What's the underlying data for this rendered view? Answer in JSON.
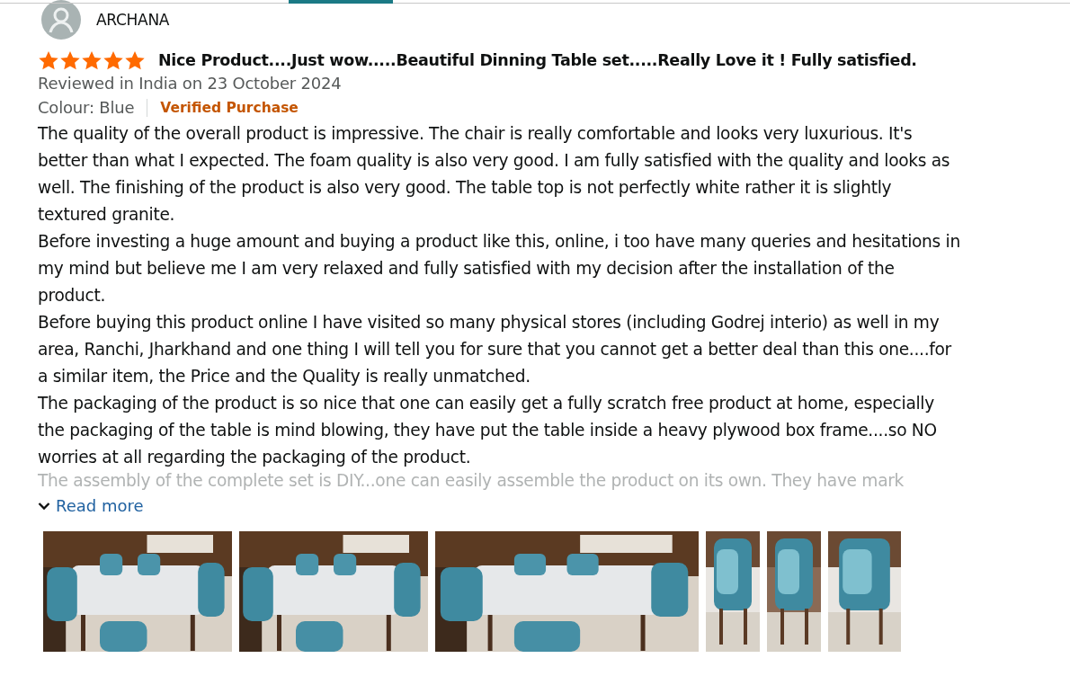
{
  "reviewer": {
    "name": "ARCHANA"
  },
  "review": {
    "stars": 5,
    "title": "Nice Product....Just wow.....Beautiful Dinning Table set.....Really Love it ! Fully satisfied.",
    "date": "Reviewed in India on 23 October 2024",
    "variant": "Colour: Blue",
    "badge": "Verified Purchase",
    "paragraphs": [
      "The quality of the overall product is impressive. The chair is really comfortable and looks very luxurious. It's better than what I expected. The foam quality is also very good. I am fully satisfied with the quality and looks as well. The finishing of the product is also very good. The table top is not perfectly white rather it is slightly textured granite.",
      "Before investing a huge amount and buying a product like this, online, i too have many queries and hesitations in my mind but believe me I am very relaxed and fully satisfied with my decision after the installation of the product.",
      "Before buying this product online I have visited so many physical stores (including Godrej interio) as well in my area, Ranchi, Jharkhand and one thing I will tell you for sure that you cannot get a better deal than this one....for a similar item, the Price and the Quality is really unmatched.",
      "The packaging of the product is so nice that one can easily get a fully scratch free product at home, especially the packaging of the table is mind blowing, they have put the table inside a heavy plywood box frame....so NO worries at all regarding the packaging of the product."
    ],
    "faded_line": "The assembly of the complete set is DIY...one can easily assemble the product on its own. They have mark",
    "read_more": "Read more",
    "photos": [
      {
        "kind": "picture"
      },
      {
        "kind": "picture"
      },
      {
        "kind": "picture"
      },
      {
        "kind": "picture"
      },
      {
        "kind": "picture"
      },
      {
        "kind": "picture"
      }
    ]
  }
}
